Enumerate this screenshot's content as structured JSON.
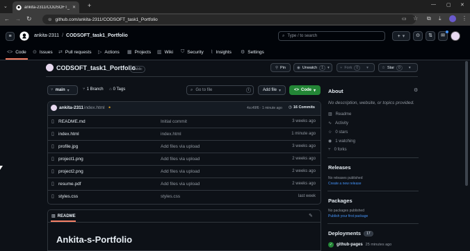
{
  "browser": {
    "tab_title": "ankita-2311/CODSOFT_task1_Po",
    "url": "github.com/ankita-2311/CODSOFT_task1_Portfolio"
  },
  "header": {
    "owner": "ankita-2311",
    "separator": "/",
    "repo": "CODSOFT_task1_Portfolio",
    "search_placeholder": "Type / to search",
    "search_key": "/"
  },
  "nav": {
    "code": "Code",
    "issues": "Issues",
    "pulls": "Pull requests",
    "actions": "Actions",
    "projects": "Projects",
    "wiki": "Wiki",
    "security": "Security",
    "insights": "Insights",
    "settings": "Settings"
  },
  "repo": {
    "name": "CODSOFT_task1_Portfolio",
    "visibility": "Public",
    "pin": "Pin",
    "unwatch": "Unwatch",
    "watch_count": "1",
    "fork": "Fork",
    "fork_count": "0",
    "star": "Star",
    "star_count": "0"
  },
  "toolbar": {
    "branch": "main",
    "branches": "1 Branch",
    "tags": "0 Tags",
    "goto_file": "Go to file",
    "goto_key": "t",
    "add_file": "Add file",
    "code": "Code"
  },
  "commit": {
    "author": "ankita-2311",
    "message": "index.html",
    "status_dot": "•",
    "hash_time": "4cc49f6 · 1 minute ago",
    "commits": "16 Commits"
  },
  "files": [
    {
      "name": "README.md",
      "commit": "Initial commit",
      "time": "3 weeks ago"
    },
    {
      "name": "index.html",
      "commit": "index.html",
      "time": "1 minute ago"
    },
    {
      "name": "profile.jpg",
      "commit": "Add files via upload",
      "time": "3 weeks ago"
    },
    {
      "name": "project1.png",
      "commit": "Add files via upload",
      "time": "2 weeks ago"
    },
    {
      "name": "project2.png",
      "commit": "Add files via upload",
      "time": "2 weeks ago"
    },
    {
      "name": "resume.pdf",
      "commit": "Add files via upload",
      "time": "2 weeks ago"
    },
    {
      "name": "styles.css",
      "commit": "styles.css",
      "time": "last week"
    }
  ],
  "readme": {
    "tab": "README",
    "heading": "Ankita-s-Portfolio"
  },
  "about": {
    "title": "About",
    "desc": "No description, website, or topics provided.",
    "readme": "Readme",
    "activity": "Activity",
    "stars": "0 stars",
    "watching": "1 watching",
    "forks": "0 forks"
  },
  "releases": {
    "title": "Releases",
    "none": "No releases published",
    "create": "Create a new release"
  },
  "packages": {
    "title": "Packages",
    "none": "No packages published",
    "publish": "Publish your first package"
  },
  "deployments": {
    "title": "Deployments",
    "count": "17",
    "env": "github-pages",
    "time": "25 minutes ago"
  },
  "colors": {
    "accent": "#238636",
    "link": "#4493f8",
    "bg": "#0d1117",
    "commit_dot": "#d29922"
  }
}
